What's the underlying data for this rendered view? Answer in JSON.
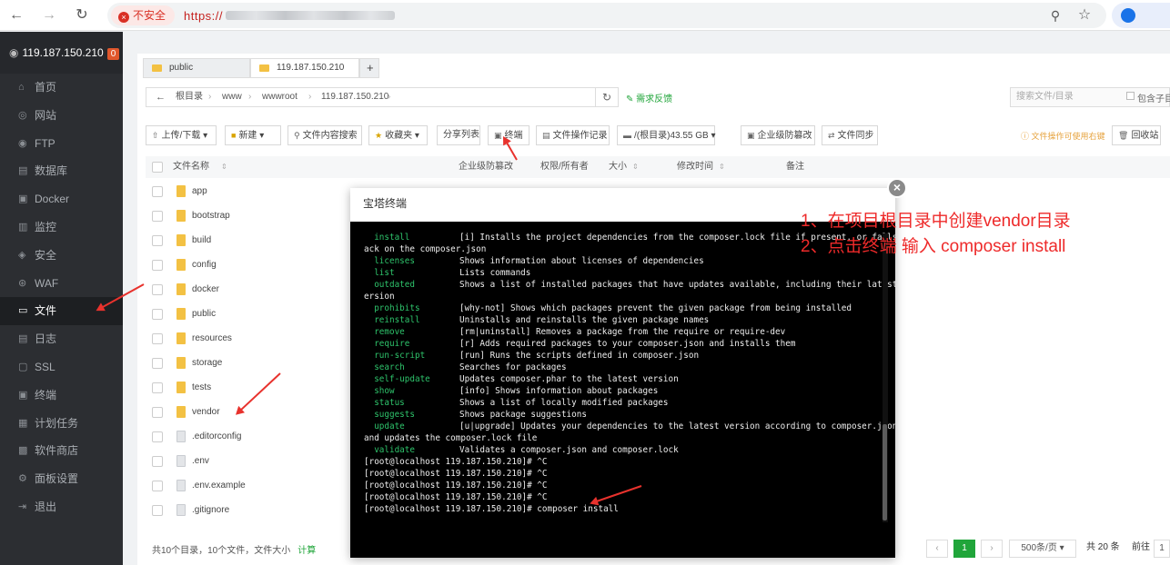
{
  "browser": {
    "security_label": "不安全",
    "url_visible": "https://"
  },
  "sidebar": {
    "server_ip": "119.187.150.210",
    "badge": "0",
    "items": [
      {
        "label": "首页",
        "icon": "home-icon"
      },
      {
        "label": "网站",
        "icon": "globe-icon"
      },
      {
        "label": "FTP",
        "icon": "ftp-icon"
      },
      {
        "label": "数据库",
        "icon": "database-icon"
      },
      {
        "label": "Docker",
        "icon": "docker-icon"
      },
      {
        "label": "监控",
        "icon": "monitor-icon"
      },
      {
        "label": "安全",
        "icon": "shield-icon"
      },
      {
        "label": "WAF",
        "icon": "waf-icon"
      },
      {
        "label": "文件",
        "icon": "folder-icon"
      },
      {
        "label": "日志",
        "icon": "log-icon"
      },
      {
        "label": "SSL",
        "icon": "ssl-icon"
      },
      {
        "label": "终端",
        "icon": "terminal-icon"
      },
      {
        "label": "计划任务",
        "icon": "task-icon"
      },
      {
        "label": "软件商店",
        "icon": "store-icon"
      },
      {
        "label": "面板设置",
        "icon": "settings-icon"
      },
      {
        "label": "退出",
        "icon": "logout-icon"
      }
    ]
  },
  "file_tabs": [
    "public",
    "119.187.150.210",
    "+"
  ],
  "breadcrumb": [
    "根目录",
    "www",
    "wwwroot",
    "119.187.150.210"
  ],
  "feedback": "需求反馈",
  "search": {
    "placeholder": "搜索文件/目录",
    "include_sub": "包含子目"
  },
  "toolbar": {
    "upload": "上传/下载",
    "new": "新建",
    "content_search": "文件内容搜索",
    "favorites": "收藏夹",
    "share_list": "分享列表",
    "terminal": "终端",
    "operation_log": "文件操作记录",
    "disk": "/(根目录)43.55 GB",
    "tamper": "企业级防篡改",
    "sync": "文件同步",
    "hint": "文件操作可使用右键",
    "recycle": "回收站"
  },
  "table": {
    "headers": {
      "name": "文件名称",
      "tamper": "企业级防篡改",
      "perm": "权限/所有者",
      "size": "大小",
      "mtime": "修改时间",
      "remark": "备注"
    },
    "files": [
      {
        "name": "app",
        "type": "folder"
      },
      {
        "name": "bootstrap",
        "type": "folder"
      },
      {
        "name": "build",
        "type": "folder"
      },
      {
        "name": "config",
        "type": "folder"
      },
      {
        "name": "docker",
        "type": "folder"
      },
      {
        "name": "public",
        "type": "folder"
      },
      {
        "name": "resources",
        "type": "folder"
      },
      {
        "name": "storage",
        "type": "folder"
      },
      {
        "name": "tests",
        "type": "folder"
      },
      {
        "name": "vendor",
        "type": "folder"
      },
      {
        "name": ".editorconfig",
        "type": "file"
      },
      {
        "name": ".env",
        "type": "file"
      },
      {
        "name": ".env.example",
        "type": "file"
      },
      {
        "name": ".gitignore",
        "type": "file"
      }
    ]
  },
  "footer": {
    "summary": "共10个目录，10个文件，文件大小",
    "calc": "计算"
  },
  "pagination": {
    "current": "1",
    "per_page": "500条/页",
    "total": "共 20 条",
    "goto": "前往",
    "goto_value": "1"
  },
  "terminal": {
    "title": "宝塔终端",
    "lines": [
      {
        "cmd": "  install",
        "desc": "[i] Installs the project dependencies from the composer.lock file if present, or falls b"
      },
      {
        "cmd": "",
        "desc": "ack on the composer.json"
      },
      {
        "cmd": "  licenses",
        "desc": "Shows information about licenses of dependencies"
      },
      {
        "cmd": "  list",
        "desc": "Lists commands"
      },
      {
        "cmd": "  outdated",
        "desc": "Shows a list of installed packages that have updates available, including their latest v"
      },
      {
        "cmd": "",
        "desc": "ersion"
      },
      {
        "cmd": "  prohibits",
        "desc": "[why-not] Shows which packages prevent the given package from being installed"
      },
      {
        "cmd": "  reinstall",
        "desc": "Uninstalls and reinstalls the given package names"
      },
      {
        "cmd": "  remove",
        "desc": "[rm|uninstall] Removes a package from the require or require-dev"
      },
      {
        "cmd": "  require",
        "desc": "[r] Adds required packages to your composer.json and installs them"
      },
      {
        "cmd": "  run-script",
        "desc": "[run] Runs the scripts defined in composer.json"
      },
      {
        "cmd": "  search",
        "desc": "Searches for packages"
      },
      {
        "cmd": "  self-update",
        "desc": "Updates composer.phar to the latest version"
      },
      {
        "cmd": "  show",
        "desc": "[info] Shows information about packages"
      },
      {
        "cmd": "  status",
        "desc": "Shows a list of locally modified packages"
      },
      {
        "cmd": "  suggests",
        "desc": "Shows package suggestions"
      },
      {
        "cmd": "  update",
        "desc": "[u|upgrade] Updates your dependencies to the latest version according to composer.json,"
      },
      {
        "cmd": "",
        "desc": "and updates the composer.lock file"
      },
      {
        "cmd": "  validate",
        "desc": "Validates a composer.json and composer.lock"
      },
      {
        "cmd": "",
        "desc": "[root@localhost 119.187.150.210]# ^C"
      },
      {
        "cmd": "",
        "desc": "[root@localhost 119.187.150.210]# ^C"
      },
      {
        "cmd": "",
        "desc": "[root@localhost 119.187.150.210]# ^C"
      },
      {
        "cmd": "",
        "desc": "[root@localhost 119.187.150.210]# ^C"
      },
      {
        "cmd": "",
        "desc": "[root@localhost 119.187.150.210]# composer install"
      }
    ]
  },
  "annotations": {
    "step1": "1、在项目根目录中创建vendor目录",
    "step2": "2、点击终端 输入 composer install",
    "color": "#ee2a2a"
  }
}
